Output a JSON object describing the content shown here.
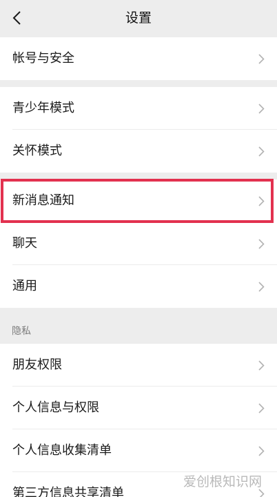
{
  "header": {
    "title": "设置"
  },
  "groups": [
    {
      "items": [
        {
          "label": "帐号与安全"
        }
      ]
    },
    {
      "items": [
        {
          "label": "青少年模式"
        },
        {
          "label": "关怀模式"
        }
      ]
    },
    {
      "items": [
        {
          "label": "新消息通知"
        },
        {
          "label": "聊天"
        },
        {
          "label": "通用"
        }
      ]
    }
  ],
  "privacy": {
    "section_label": "隐私",
    "items": [
      {
        "label": "朋友权限"
      },
      {
        "label": "个人信息与权限"
      },
      {
        "label": "个人信息收集清单"
      },
      {
        "label": "第三方信息共享清单"
      }
    ]
  },
  "highlighted_item": "新消息通知",
  "watermark": "爱创根知识网",
  "colors": {
    "background": "#ededed",
    "row_background": "#ffffff",
    "highlight_border": "#e2314f",
    "chevron": "#b2b2b2",
    "section_label": "#7c7c7c"
  }
}
